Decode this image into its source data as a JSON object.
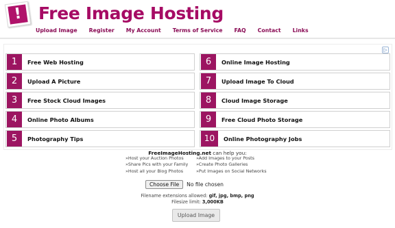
{
  "header": {
    "logo_glyph": "!",
    "site_title": "Free Image Hosting",
    "brand_color": "#a60b64"
  },
  "nav": {
    "items": [
      {
        "label": "Upload Image"
      },
      {
        "label": "Register"
      },
      {
        "label": "My Account"
      },
      {
        "label": "Terms of Service"
      },
      {
        "label": "FAQ"
      },
      {
        "label": "Contact"
      },
      {
        "label": "Links"
      }
    ]
  },
  "ad": {
    "choices_icon": "ad-choices-icon",
    "left_items": [
      {
        "num": "1",
        "label": "Free Web Hosting"
      },
      {
        "num": "2",
        "label": "Upload A Picture"
      },
      {
        "num": "3",
        "label": "Free Stock Cloud Images"
      },
      {
        "num": "4",
        "label": "Online Photo Albums"
      },
      {
        "num": "5",
        "label": "Photography Tips"
      }
    ],
    "right_items": [
      {
        "num": "6",
        "label": "Online Image Hosting"
      },
      {
        "num": "7",
        "label": "Upload Image To Cloud"
      },
      {
        "num": "8",
        "label": "Cloud Image Storage"
      },
      {
        "num": "9",
        "label": "Free Cloud Photo Storage"
      },
      {
        "num": "10",
        "label": "Online Photography Jobs"
      }
    ],
    "accent_color": "#9c1561"
  },
  "upload": {
    "help_brand": "FreeImageHosting.net",
    "help_suffix": " can help you:",
    "help_left": [
      "»Host your Auction Photos",
      "»Share Pics with your Family",
      "»Host all your Blog Photos"
    ],
    "help_right": [
      "»Add Images to your Posts",
      "»Create Photo Galleries",
      "»Put Images on Social Networks"
    ],
    "choose_file_label": "Choose File",
    "file_status": "No file chosen",
    "extensions_label": "Filename extensions allowed: ",
    "extensions_value": "gif, jpg, bmp, png",
    "filesize_label": "Filesize limit: ",
    "filesize_value": "3,000KB",
    "upload_button_label": "Upload Image"
  }
}
